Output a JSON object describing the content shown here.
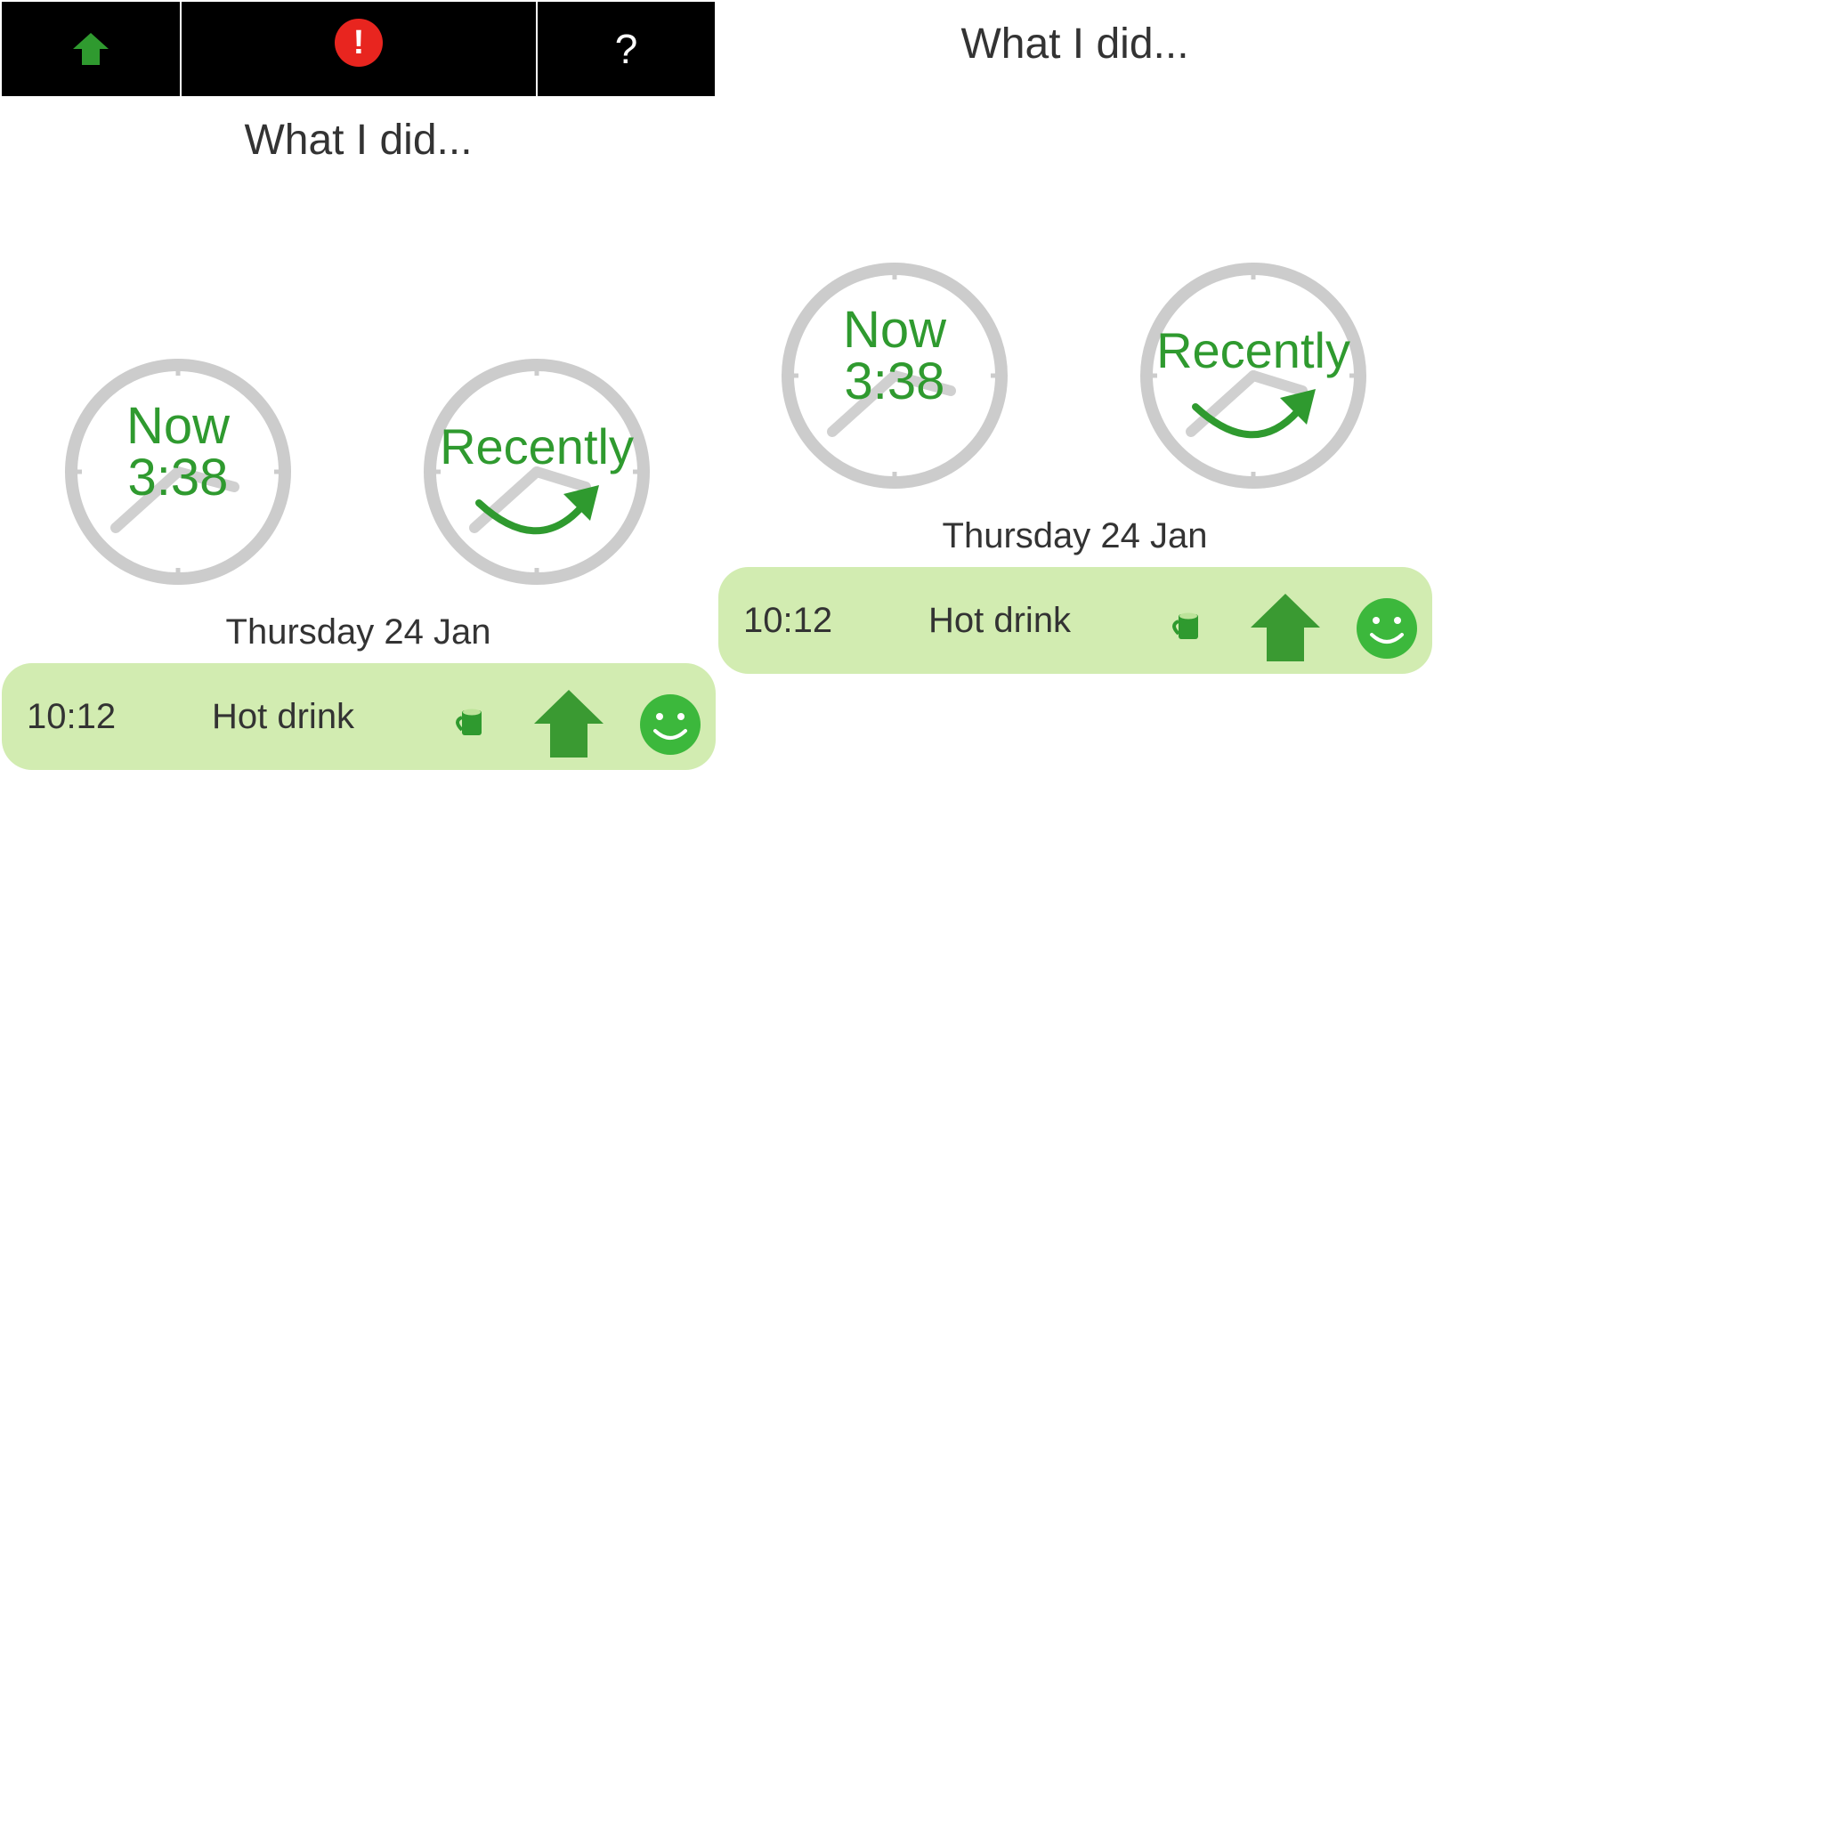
{
  "screens": [
    {
      "toolbar": {
        "home_icon": "home-icon",
        "alert_icon": "alert-icon",
        "alert_symbol": "!",
        "help_label": "?"
      },
      "title": "What I did...",
      "clocks": {
        "now": {
          "line1": "Now",
          "line2": "3:38"
        },
        "recently": {
          "label": "Recently"
        }
      },
      "date": "Thursday 24 Jan",
      "entry": {
        "time": "10:12",
        "label": "Hot drink",
        "icons": [
          "mug-icon",
          "house-icon",
          "smiley-icon"
        ]
      }
    },
    {
      "title": "What I did...",
      "clocks": {
        "now": {
          "line1": "Now",
          "line2": "3:38"
        },
        "recently": {
          "label": "Recently"
        }
      },
      "date": "Thursday 24 Jan",
      "entry": {
        "time": "10:12",
        "label": "Hot drink",
        "icons": [
          "mug-icon",
          "house-icon",
          "smiley-icon"
        ]
      }
    }
  ],
  "colors": {
    "accent_green": "#2f9a2f",
    "entry_background": "#d2ecb1",
    "toolbar_background": "#000000",
    "alert_red": "#e8251f",
    "clock_gray": "#cccccc"
  }
}
